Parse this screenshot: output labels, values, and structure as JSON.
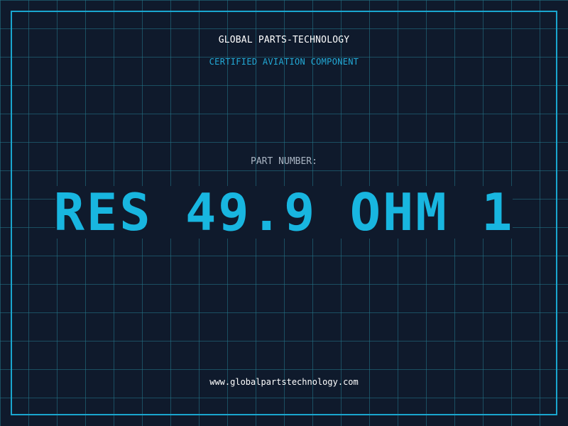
{
  "header": {
    "company": "GLOBAL PARTS-TECHNOLOGY",
    "subtitle": "CERTIFIED AVIATION COMPONENT"
  },
  "part": {
    "label": "PART NUMBER:",
    "number": "RES 49.9 OHM 1"
  },
  "footer": {
    "url": "www.globalpartstechnology.com"
  },
  "colors": {
    "background": "#0f1a2c",
    "grid": "#24788c",
    "frame": "#1aa6cf",
    "accent": "#18b6e0"
  }
}
